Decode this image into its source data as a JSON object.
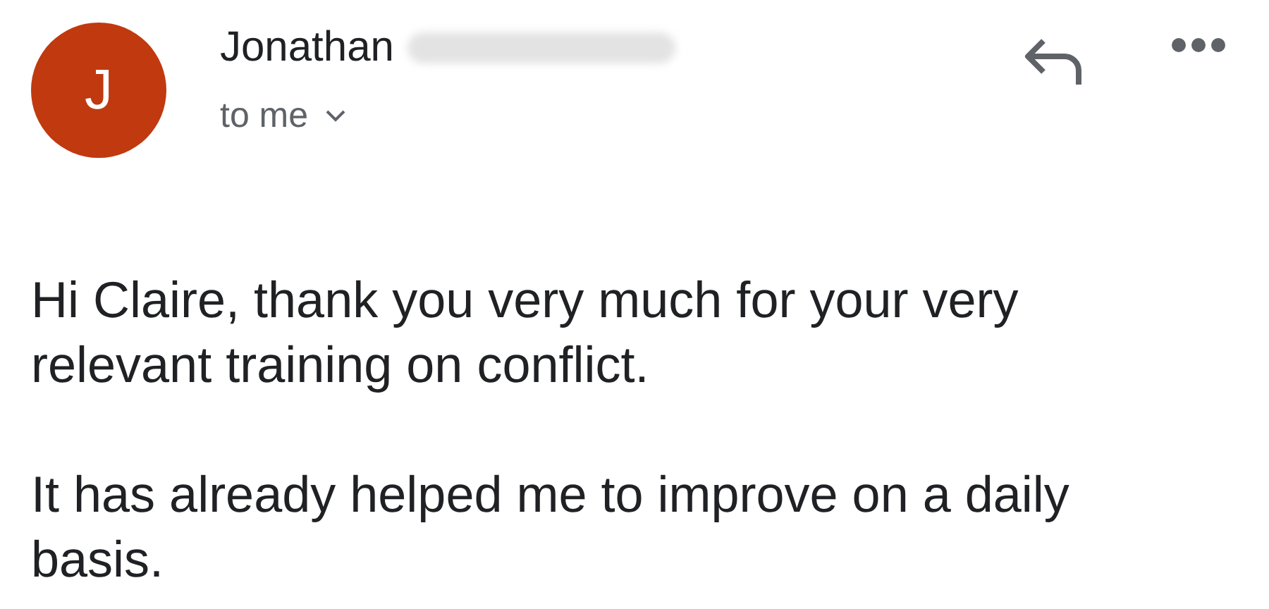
{
  "sender": {
    "initial": "J",
    "name": "Jonathan",
    "recipient": "to me"
  },
  "body": [
    "Hi Claire, thank you very much for your very relevant training on conflict.",
    "It has already helped me to improve on a daily basis."
  ]
}
